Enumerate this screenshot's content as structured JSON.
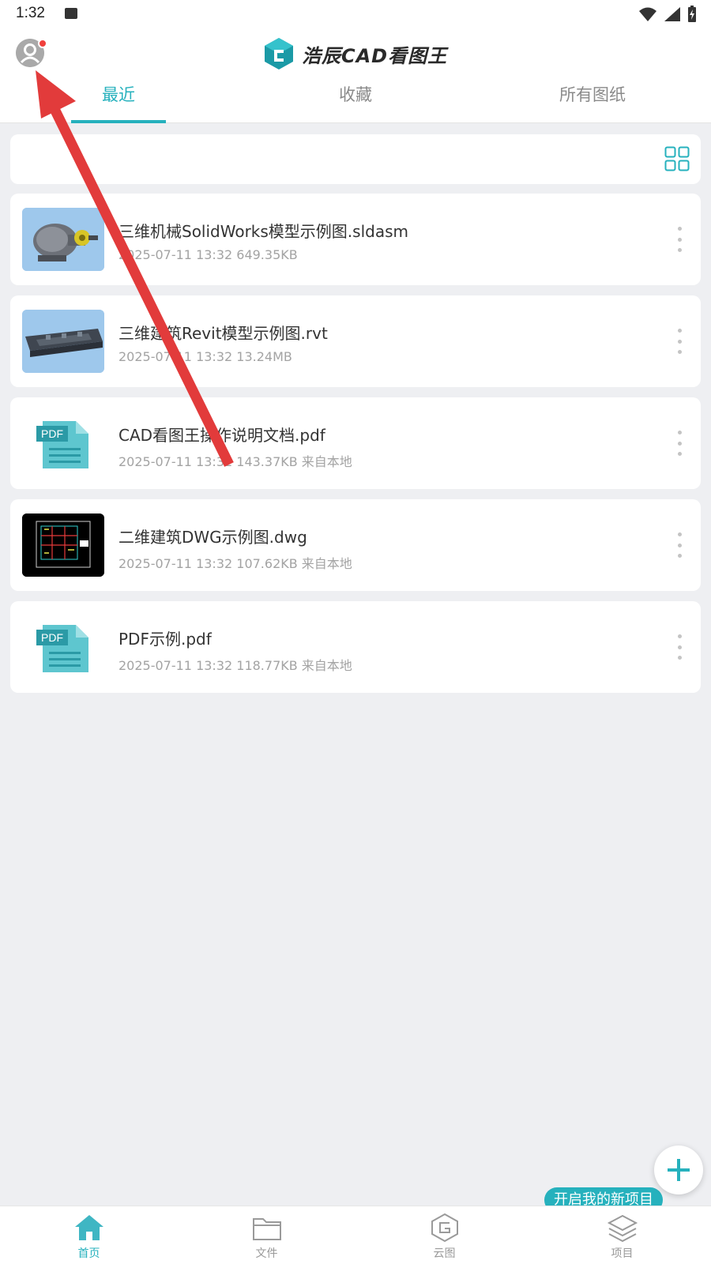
{
  "status_bar": {
    "time": "1:32"
  },
  "header": {
    "logo_text": "浩辰CAD看图王",
    "tabs": [
      {
        "label": "最近",
        "active": true
      },
      {
        "label": "收藏",
        "active": false
      },
      {
        "label": "所有图纸",
        "active": false
      }
    ]
  },
  "files": [
    {
      "name": "三维机械SolidWorks模型示例图.sldasm",
      "date": "2025-07-11 13:32",
      "size": "649.35KB",
      "source": "",
      "thumb": "mechanical-3d"
    },
    {
      "name": "三维建筑Revit模型示例图.rvt",
      "date": "2025-07-11 13:32",
      "size": "13.24MB",
      "source": "",
      "thumb": "building-3d"
    },
    {
      "name": "CAD看图王操作说明文档.pdf",
      "date": "2025-07-11 13:32",
      "size": "143.37KB",
      "source": "来自本地",
      "thumb": "pdf"
    },
    {
      "name": "二维建筑DWG示例图.dwg",
      "date": "2025-07-11 13:32",
      "size": "107.62KB",
      "source": "来自本地",
      "thumb": "dwg-2d"
    },
    {
      "name": "PDF示例.pdf",
      "date": "2025-07-11 13:32",
      "size": "118.77KB",
      "source": "来自本地",
      "thumb": "pdf"
    }
  ],
  "meta_lines": [
    "2025-07-11 13:32  649.35KB",
    "2025-07-11 13:32  13.24MB",
    "2025-07-11 13:32  143.37KB  来自本地",
    "2025-07-11 13:32  107.62KB  来自本地",
    "2025-07-11 13:32  118.77KB  来自本地"
  ],
  "pdf_badge": "PDF",
  "fab": {
    "tooltip": "开启我的新项目"
  },
  "bottom_nav": [
    {
      "label": "首页",
      "icon": "home-icon",
      "active": true
    },
    {
      "label": "文件",
      "icon": "folder-icon",
      "active": false
    },
    {
      "label": "云图",
      "icon": "cloud-drawing-icon",
      "active": false
    },
    {
      "label": "项目",
      "icon": "layers-icon",
      "active": false
    }
  ],
  "colors": {
    "accent": "#26b1bd",
    "badge_red": "#f0403c",
    "annotation_arrow": "#e23b3b",
    "background": "#eeeff2"
  }
}
